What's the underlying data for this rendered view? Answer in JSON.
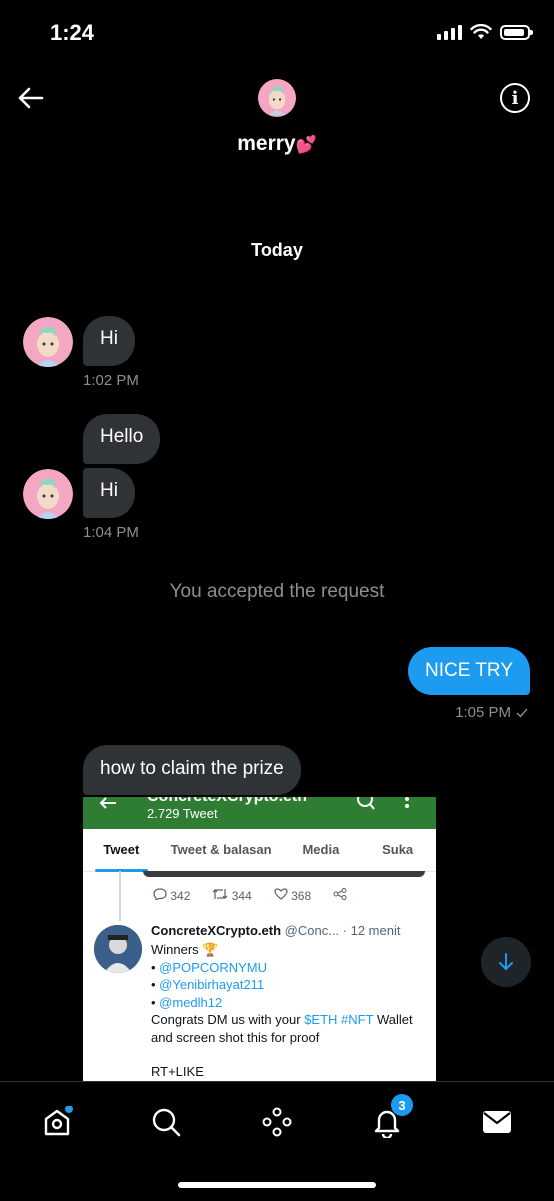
{
  "status_bar": {
    "time": "1:24"
  },
  "header": {
    "contact_name": "merry"
  },
  "conversation": {
    "date_label": "Today",
    "messages": [
      {
        "text": "Hi",
        "time": "1:02 PM"
      },
      {
        "text": "Hello"
      },
      {
        "text": "Hi",
        "time": "1:04 PM"
      }
    ],
    "system_note": "You accepted the request",
    "sent": {
      "text": "NICE TRY",
      "time": "1:05 PM"
    },
    "last_received": {
      "text": "how to claim the prize"
    }
  },
  "screenshot": {
    "profile_name": "ConcreteXCrypto.eth",
    "tweet_count": "2.729 Tweet",
    "tabs": [
      "Tweet",
      "Tweet & balasan",
      "Media",
      "Suka"
    ],
    "stats": {
      "replies": "342",
      "retweets": "344",
      "likes": "368"
    },
    "tweet": {
      "author": "ConcreteXCrypto.eth",
      "handle": "@Conc...",
      "time": "· 12 menit",
      "line1": "Winners",
      "trophy": "🏆",
      "mentions": [
        "@POPCORNYMU",
        "@Yenibirhayat211",
        "@medlh12"
      ],
      "body_a": "Congrats DM us with your",
      "tag1": "$ETH",
      "tag2": "#NFT",
      "body_b": "Wallet",
      "body_c": "and screen shot this for proof",
      "body_d": "RT+LIKE"
    }
  },
  "bottom_nav": {
    "notification_count": "3"
  },
  "colors": {
    "accent": "#1d9bf0",
    "bubble": "#2f3336",
    "muted": "#8b8f94"
  }
}
